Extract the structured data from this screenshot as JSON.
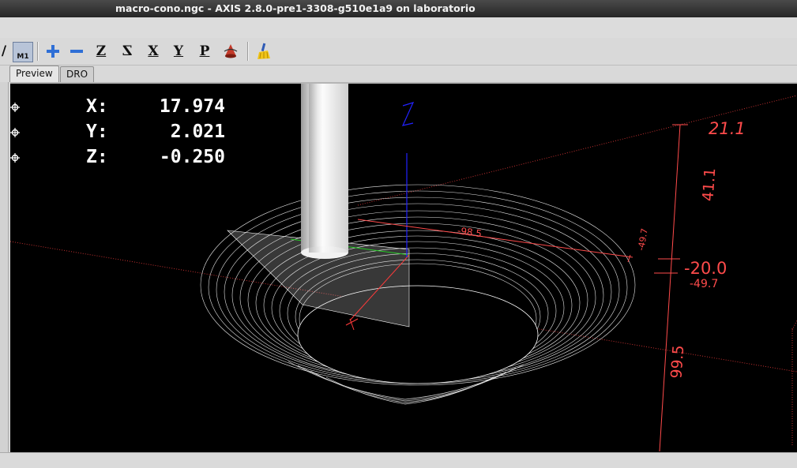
{
  "window": {
    "title": "macro-cono.ngc - AXIS 2.8.0-pre1-3308-g510e1a9 on laboratorio"
  },
  "toolbar": {
    "buttons": [
      {
        "name": "tool-slash-button",
        "glyph": "/"
      },
      {
        "name": "machine-m1-button",
        "glyph": "M1"
      },
      {
        "name": "zoom-in-button",
        "glyph": "+"
      },
      {
        "name": "zoom-out-button",
        "glyph": "−"
      },
      {
        "name": "view-z-button",
        "glyph": "Z"
      },
      {
        "name": "view-z-rotated-button",
        "glyph": "Z"
      },
      {
        "name": "view-x-button",
        "glyph": "X"
      },
      {
        "name": "view-y-button",
        "glyph": "Y"
      },
      {
        "name": "view-p-button",
        "glyph": "P"
      },
      {
        "name": "rotate-view-button",
        "glyph": ""
      },
      {
        "name": "clear-backplot-button",
        "glyph": ""
      }
    ]
  },
  "tabs": [
    {
      "label": "Preview",
      "active": true
    },
    {
      "label": "DRO",
      "active": false
    }
  ],
  "dro": [
    {
      "axis": "X:",
      "value": "17.974"
    },
    {
      "axis": "Y:",
      "value": "2.021"
    },
    {
      "axis": "Z:",
      "value": "-0.250"
    }
  ],
  "dimensions": {
    "top": "21.1",
    "vertical_1": "41.1",
    "side_1": "-20.0",
    "side_2": "-49.7",
    "vertical_2": "99.5",
    "small": "-49.7",
    "diagonal": "-98.5"
  },
  "colors": {
    "background": "#000000",
    "dimension": "#ff4b4b",
    "z_axis": "#2222ff",
    "toolpath": "#ffffff",
    "origin_x": "#00cc00"
  }
}
